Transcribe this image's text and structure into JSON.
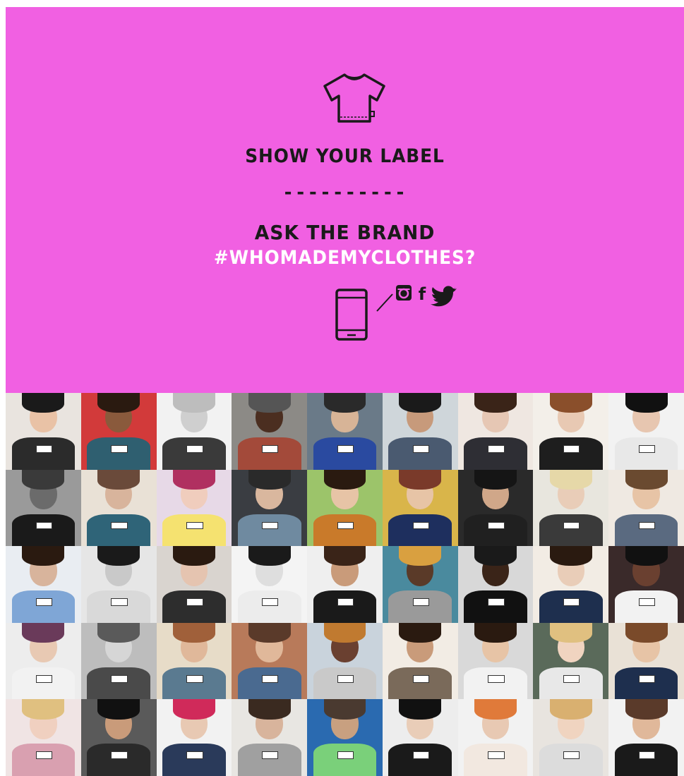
{
  "campaign": {
    "headline": "SHOW YOUR LABEL",
    "divider": "----------",
    "call_to_action": "ASK THE BRAND",
    "hashtag": "#WHOMADEMYCLOTHES?",
    "social_letter": "f"
  },
  "icons": [
    "tshirt-icon",
    "smartphone-icon",
    "instagram-icon",
    "facebook-icon",
    "twitter-icon"
  ],
  "colors": {
    "panel": "#f160e2",
    "ink": "#1a1a1a",
    "hashtag": "#ffffff"
  },
  "photo_grid": {
    "columns": 9,
    "rows": 5,
    "tiles": [
      {
        "bg": "#e9e4df",
        "skin": "#e9c2a6",
        "hair": "#1a1a1a",
        "garment": "#2b2b2b"
      },
      {
        "bg": "#d23a3a",
        "skin": "#8a5a3c",
        "hair": "#2a1a10",
        "garment": "#2f5f70"
      },
      {
        "bg": "#f2f2f2",
        "skin": "#cfcfcf",
        "hair": "#bdbdbd",
        "garment": "#3a3a3a"
      },
      {
        "bg": "#8c8a86",
        "skin": "#4b2e20",
        "hair": "#555555",
        "garment": "#a34a3a"
      },
      {
        "bg": "#6a7a88",
        "skin": "#d7b497",
        "hair": "#2a2a2a",
        "garment": "#2a4aa0"
      },
      {
        "bg": "#cfd6da",
        "skin": "#c79a7b",
        "hair": "#1a1a1a",
        "garment": "#4a5a70"
      },
      {
        "bg": "#efe7e1",
        "skin": "#e6c7b4",
        "hair": "#3a2418",
        "garment": "#2e2e34"
      },
      {
        "bg": "#f3efe9",
        "skin": "#e8c9b3",
        "hair": "#8a4f2b",
        "garment": "#1e1e1e"
      },
      {
        "bg": "#f2f2f2",
        "skin": "#e7c6b0",
        "hair": "#111111",
        "garment": "#e8e8e8"
      },
      {
        "bg": "#9a9a9a",
        "skin": "#6b6b6b",
        "hair": "#3a3a3a",
        "garment": "#1a1a1a"
      },
      {
        "bg": "#e9e1d6",
        "skin": "#d8b49c",
        "hair": "#6a4a3a",
        "garment": "#2f6478"
      },
      {
        "bg": "#e7d9e7",
        "skin": "#f0cdbd",
        "hair": "#b03060",
        "garment": "#f5e270"
      },
      {
        "bg": "#3a3d42",
        "skin": "#d9b79e",
        "hair": "#2a2a2a",
        "garment": "#6f8aa0"
      },
      {
        "bg": "#9cc46a",
        "skin": "#e7c4a6",
        "hair": "#2a1a10",
        "garment": "#c97a2a"
      },
      {
        "bg": "#d9b54a",
        "skin": "#e7c4a6",
        "hair": "#7a3a2a",
        "garment": "#1e2f5e"
      },
      {
        "bg": "#2a2a2a",
        "skin": "#d0a789",
        "hair": "#151515",
        "garment": "#202020"
      },
      {
        "bg": "#e8e6de",
        "skin": "#e9cdb8",
        "hair": "#e6d8a8",
        "garment": "#3a3a3a"
      },
      {
        "bg": "#efe9e2",
        "skin": "#e7c4a6",
        "hair": "#6a4a30",
        "garment": "#5a6a80"
      },
      {
        "bg": "#e9edf2",
        "skin": "#d8b49c",
        "hair": "#2a1a10",
        "garment": "#7fa6d6"
      },
      {
        "bg": "#e6e6e6",
        "skin": "#c9c9c9",
        "hair": "#1a1a1a",
        "garment": "#d9d9d9"
      },
      {
        "bg": "#d9d4cf",
        "skin": "#e5c4b0",
        "hair": "#2a1a10",
        "garment": "#2d2d2d"
      },
      {
        "bg": "#f4f4f4",
        "skin": "#dedede",
        "hair": "#1a1a1a",
        "garment": "#ececec"
      },
      {
        "bg": "#efefef",
        "skin": "#c99b7a",
        "hair": "#3a2418",
        "garment": "#1a1a1a"
      },
      {
        "bg": "#4a8a9e",
        "skin": "#5a3a28",
        "hair": "#d9a040",
        "garment": "#9a9a9a"
      },
      {
        "bg": "#d8d8d8",
        "skin": "#3a2418",
        "hair": "#1a1a1a",
        "garment": "#111111"
      },
      {
        "bg": "#f2ece4",
        "skin": "#e9cdb8",
        "hair": "#2a1a10",
        "garment": "#1e2f4e"
      },
      {
        "bg": "#3a2a2a",
        "skin": "#6a4030",
        "hair": "#111111",
        "garment": "#f2f2f2"
      },
      {
        "bg": "#ededed",
        "skin": "#e8c9b3",
        "hair": "#6a3a5a",
        "garment": "#f2f2f2"
      },
      {
        "bg": "#bdbdbd",
        "skin": "#d6d6d6",
        "hair": "#5a5a5a",
        "garment": "#4a4a4a"
      },
      {
        "bg": "#e7dcc8",
        "skin": "#e0b89a",
        "hair": "#a0603a",
        "garment": "#5a7a90"
      },
      {
        "bg": "#b87a5a",
        "skin": "#e0b89a",
        "hair": "#5a3a2a",
        "garment": "#4a6a90"
      },
      {
        "bg": "#c9d3dc",
        "skin": "#6a4030",
        "hair": "#c07a30",
        "garment": "#c9c9c9"
      },
      {
        "bg": "#f2ece4",
        "skin": "#c99b7a",
        "hair": "#2a1a10",
        "garment": "#7a6a5a"
      },
      {
        "bg": "#d9d9d9",
        "skin": "#e7c4a6",
        "hair": "#2a1a10",
        "garment": "#f2f2f2"
      },
      {
        "bg": "#5a6a5a",
        "skin": "#f0d4c0",
        "hair": "#e0c080",
        "garment": "#e8e8e8"
      },
      {
        "bg": "#e9e1d6",
        "skin": "#e7c4a6",
        "hair": "#7a4a2a",
        "garment": "#1e2f4e"
      },
      {
        "bg": "#f0e4e4",
        "skin": "#f0d0c0",
        "hair": "#e0c080",
        "garment": "#d9a0b0"
      },
      {
        "bg": "#5a5a5a",
        "skin": "#c99b7a",
        "hair": "#111111",
        "garment": "#2a2a2a"
      },
      {
        "bg": "#f2f2f2",
        "skin": "#e8c9b3",
        "hair": "#d02a5a",
        "garment": "#2a3a5a"
      },
      {
        "bg": "#e8e6e2",
        "skin": "#d8b49c",
        "hair": "#3a2a20",
        "garment": "#a0a0a0"
      },
      {
        "bg": "#2a6ab0",
        "skin": "#c8a080",
        "hair": "#4a3a30",
        "garment": "#7ad07a"
      },
      {
        "bg": "#ededed",
        "skin": "#e9cdb8",
        "hair": "#111111",
        "garment": "#1a1a1a"
      },
      {
        "bg": "#f2f2f2",
        "skin": "#e8c9b3",
        "hair": "#e07a3a",
        "garment": "#f2e8e0"
      },
      {
        "bg": "#e8e4df",
        "skin": "#f0d4c0",
        "hair": "#d9b070",
        "garment": "#dcdcdc"
      },
      {
        "bg": "#f2f2f2",
        "skin": "#e0b89a",
        "hair": "#5a3a2a",
        "garment": "#1a1a1a"
      }
    ]
  }
}
